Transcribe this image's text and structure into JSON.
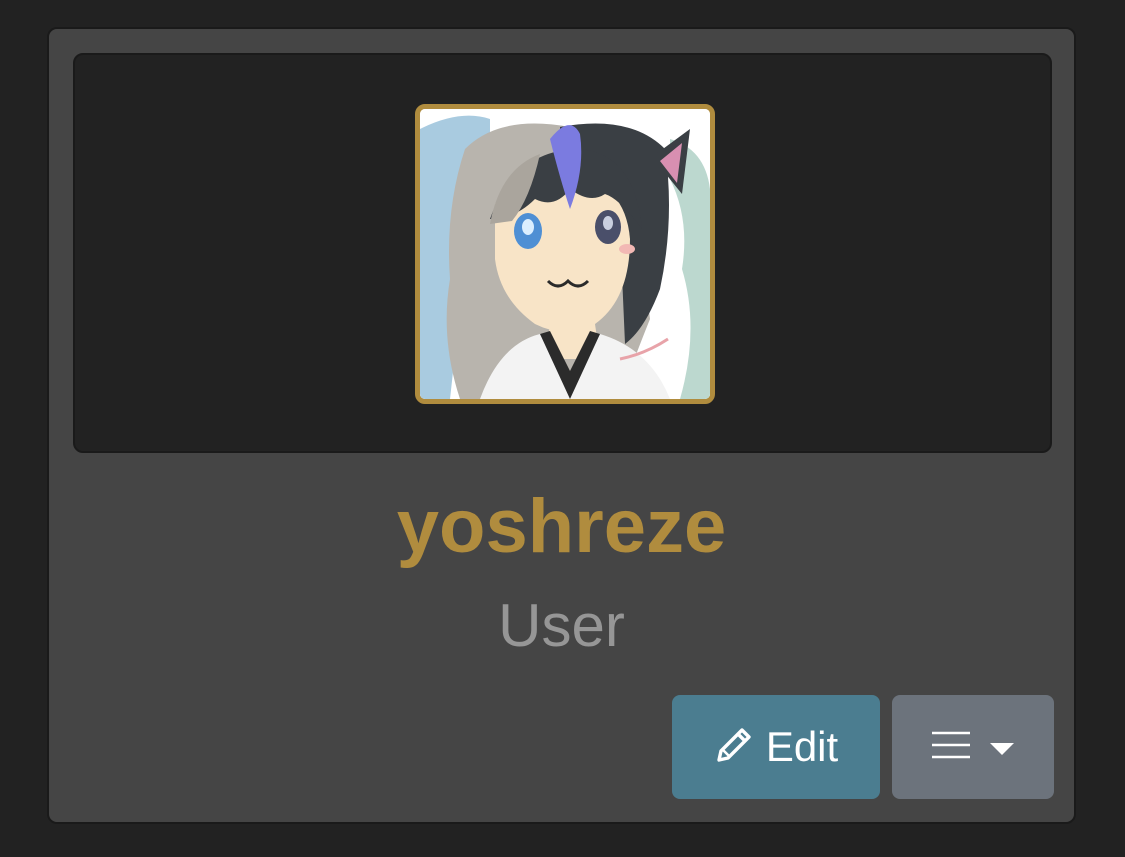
{
  "profile": {
    "username": "yoshreze",
    "role": "User",
    "avatar_alt": "anime-girl-avatar"
  },
  "actions": {
    "edit_label": "Edit",
    "edit_icon": "pencil-icon",
    "menu_icon": "hamburger-menu-icon",
    "menu_caret_icon": "caret-down-icon"
  },
  "colors": {
    "page_background": "#222222",
    "card_background": "#454545",
    "banner_background": "#222222",
    "avatar_border": "#b08c3e",
    "username": "#b08c3e",
    "role": "#969696",
    "edit_button": "#4b7d90",
    "menu_button": "#6c737c"
  }
}
